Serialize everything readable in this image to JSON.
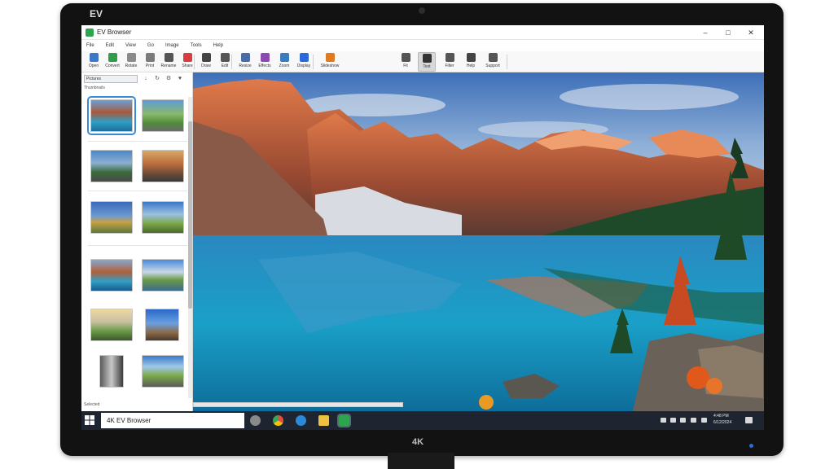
{
  "monitor": {
    "brand": "EV",
    "model": "4K"
  },
  "window": {
    "title": "EV Browser",
    "controls": [
      "–",
      "□",
      "✕"
    ]
  },
  "menu": [
    "File",
    "Edit",
    "View",
    "Go",
    "Image",
    "Tools",
    "Help"
  ],
  "toolbar": {
    "tools": [
      {
        "icon": "open-icon",
        "label": "Open",
        "color": "#3c78c8"
      },
      {
        "icon": "globe-icon",
        "label": "Convert",
        "color": "#2f9e4a"
      },
      {
        "icon": "rotate-icon",
        "label": "Rotate",
        "color": "#8a8a8a"
      },
      {
        "icon": "print-icon",
        "label": "Print",
        "color": "#7a7a7a"
      },
      {
        "icon": "pencil-icon",
        "label": "Rename",
        "color": "#555555"
      },
      {
        "icon": "info-icon",
        "label": "Share",
        "color": "#d83c3c"
      },
      {
        "icon": "edit-icon",
        "label": "Draw",
        "color": "#444444"
      },
      {
        "icon": "lines-icon",
        "label": "Edit",
        "color": "#555555"
      },
      {
        "icon": "crop-icon",
        "label": "Resize",
        "color": "#4a6aa8"
      },
      {
        "icon": "brush-icon",
        "label": "Effects",
        "color": "#8a4ab0"
      },
      {
        "icon": "zoom-icon",
        "label": "Zoom",
        "color": "#3a7abf"
      },
      {
        "icon": "paint-icon",
        "label": "Display",
        "color": "#2a6ad8"
      },
      {
        "icon": "slideshow-icon",
        "label": "Slideshow",
        "color": "#e07a20"
      },
      {
        "icon": "fit-icon",
        "label": "Fit",
        "color": "#555555"
      },
      {
        "icon": "text-icon",
        "label": "Text",
        "color": "#333333"
      },
      {
        "icon": "filter-icon",
        "label": "Filter",
        "color": "#555555"
      },
      {
        "icon": "font-icon",
        "label": "Help",
        "color": "#444444"
      },
      {
        "icon": "bell-icon",
        "label": "Support",
        "color": "#555555"
      }
    ]
  },
  "left_panel": {
    "folder_select": "Pictures",
    "folder_label": "Thumbnails",
    "status": "Selected"
  },
  "taskbar": {
    "title": "4K EV Browser",
    "time": "4:48 PM",
    "date": "6/12/2024"
  },
  "colors": {
    "accent": "#3b8ad8",
    "taskbar": "#1f2530",
    "app_icon": "#2fa44f"
  }
}
